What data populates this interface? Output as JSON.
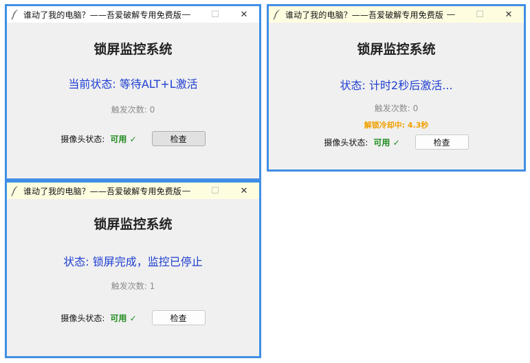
{
  "windows": [
    {
      "title": "谁动了我的电脑？——吾爱破解专用免费版",
      "app_title": "锁屏监控系统",
      "status": "当前状态: 等待ALT+L激活",
      "count": "触发次数: 0",
      "cooldown": "",
      "camera_label": "摄像头状态:",
      "camera_value": "可用 ✓",
      "check_label": "检查"
    },
    {
      "title": "谁动了我的电脑？——吾爱破解专用免费版",
      "app_title": "锁屏监控系统",
      "status": "状态: 计时2秒后激活...",
      "count": "触发次数: 0",
      "cooldown": "解锁冷却中: 4.3秒",
      "camera_label": "摄像头状态:",
      "camera_value": "可用 ✓",
      "check_label": "检查"
    },
    {
      "title": "谁动了我的电脑？——吾爱破解专用免费版",
      "app_title": "锁屏监控系统",
      "status": "状态: 锁屏完成，监控已停止",
      "count": "触发次数: 1",
      "cooldown": "",
      "camera_label": "摄像头状态:",
      "camera_value": "可用 ✓",
      "check_label": "检查"
    }
  ],
  "titlebar_buttons": {
    "minimize": "—",
    "maximize": "☐",
    "close": "✕"
  },
  "icons": {
    "app": "feather-icon"
  },
  "colors": {
    "window_border": "#3f8ee6",
    "status_text": "#1e3ed1",
    "camera_ok": "#1e8a1e",
    "cooldown_text": "#f0a000",
    "count_text": "#8c8c8c"
  }
}
